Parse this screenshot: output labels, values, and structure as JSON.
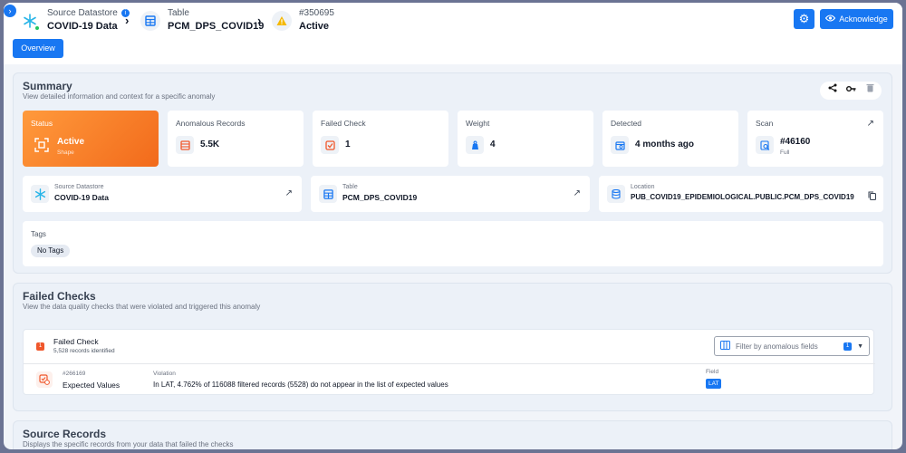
{
  "header": {
    "crumbs": [
      {
        "label": "Source Datastore",
        "value": "COVID-19 Data"
      },
      {
        "label": "Table",
        "value": "PCM_DPS_COVID19"
      },
      {
        "label": "#350695",
        "value": "Active"
      }
    ],
    "ack_label": "Acknowledge",
    "accent": "#1877f2"
  },
  "tabs": {
    "overview": "Overview"
  },
  "summary": {
    "title": "Summary",
    "subtitle": "View detailed information and context for a specific anomaly",
    "status": {
      "label": "Status",
      "value": "Active",
      "sub": "Shape"
    },
    "anomalous": {
      "label": "Anomalous Records",
      "value": "5.5K"
    },
    "failed": {
      "label": "Failed Check",
      "value": "1"
    },
    "weight": {
      "label": "Weight",
      "value": "4"
    },
    "detected": {
      "label": "Detected",
      "value": "4 months ago"
    },
    "scan": {
      "label": "Scan",
      "value": "#46160",
      "sub": "Full"
    },
    "datastore": {
      "label": "Source Datastore",
      "value": "COVID-19 Data"
    },
    "table": {
      "label": "Table",
      "value": "PCM_DPS_COVID19"
    },
    "location": {
      "label": "Location",
      "value": "PUB_COVID19_EPIDEMIOLOGICAL.PUBLIC.PCM_DPS_COVID19"
    },
    "tags": {
      "label": "Tags",
      "value": "No Tags"
    }
  },
  "failed_checks": {
    "title": "Failed Checks",
    "subtitle": "View the data quality checks that were violated and triggered this anomaly",
    "group_title": "Failed Check",
    "group_sub": "5,528 records identified",
    "group_count": "1",
    "filter_placeholder": "Filter by anomalous fields",
    "filter_count": "1",
    "check": {
      "id": "#266169",
      "name": "Expected Values",
      "violation_label": "Violation",
      "violation": "In LAT, 4.762% of 116088 filtered records (5528) do not appear in the list of expected values",
      "field_label": "Field",
      "field": "LAT"
    }
  },
  "source_records": {
    "title": "Source Records",
    "subtitle": "Displays the specific records from your data that failed the checks"
  }
}
